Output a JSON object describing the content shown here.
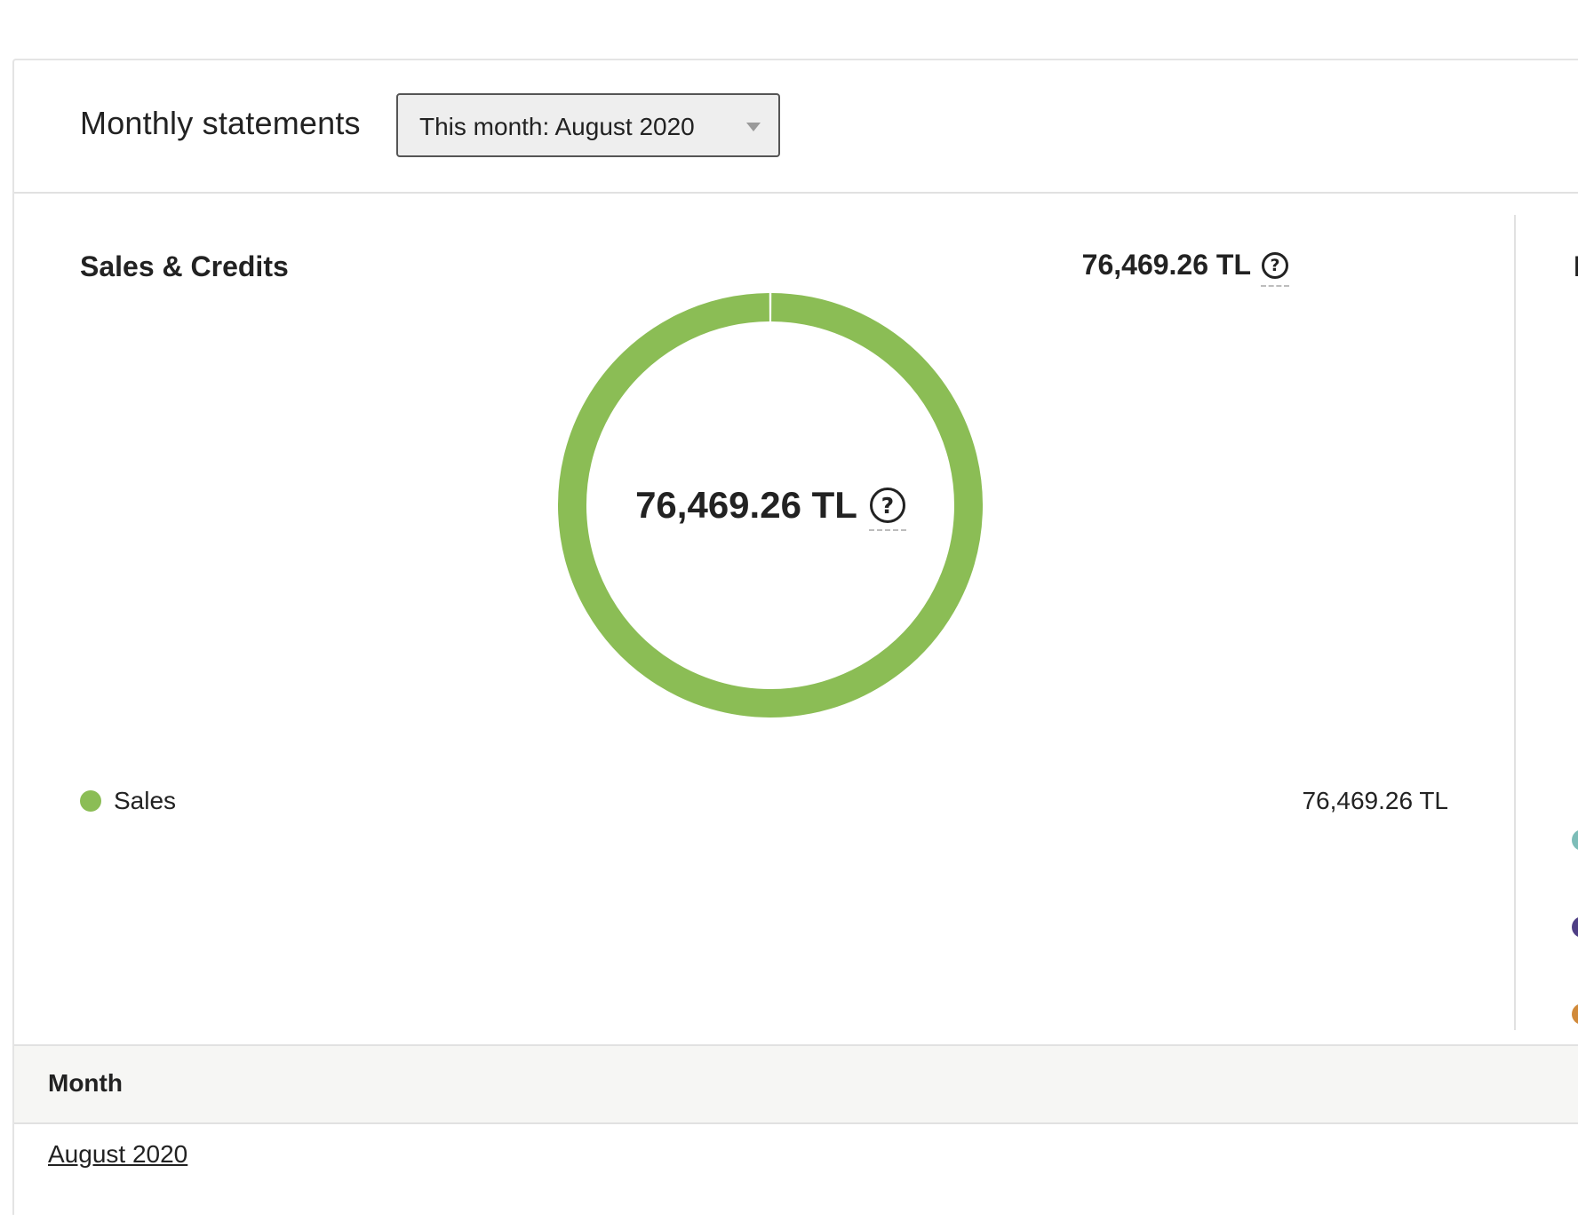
{
  "header": {
    "title": "Monthly statements",
    "period_select": {
      "selected": "This month: August 2020",
      "icon": "triangle-down-icon"
    }
  },
  "sales_credits": {
    "title": "Sales & Credits",
    "total": "76,469.26 TL",
    "center_amount": "76,469.26 TL",
    "help_icon": "question-circle-icon",
    "legend": [
      {
        "label": "Sales",
        "value": "76,469.26 TL",
        "color": "#8bbd55"
      }
    ]
  },
  "chart_data": {
    "type": "pie",
    "variant": "donut",
    "labels": [
      "Sales"
    ],
    "values": [
      76469.26
    ],
    "colors": [
      "#8bbd55"
    ]
  },
  "right_panel_partial": {
    "title_fragment": "F",
    "legend_colors": [
      "#7dbdb8",
      "#4f3f85",
      "#d18a3a"
    ]
  },
  "table": {
    "columns": [
      "Month"
    ],
    "rows": [
      {
        "month": "August 2020"
      }
    ]
  }
}
